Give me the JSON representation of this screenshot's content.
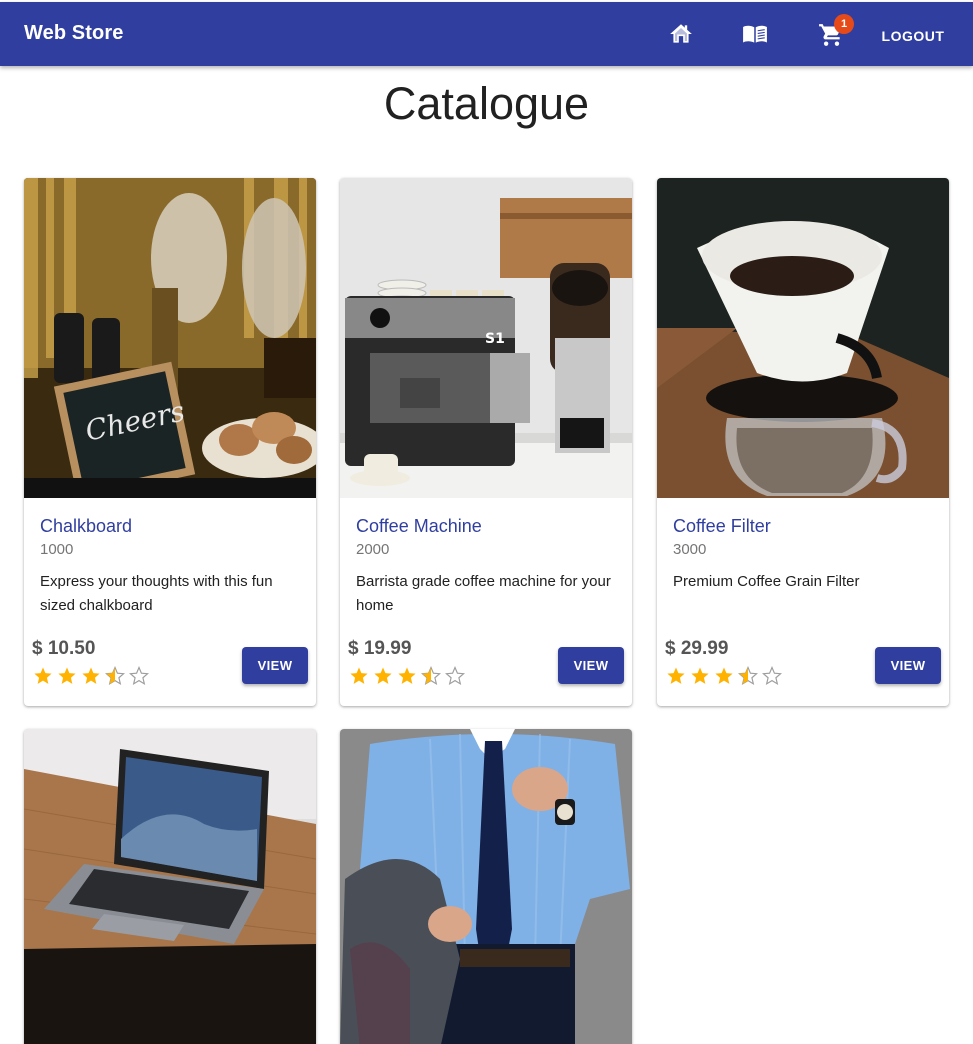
{
  "app": {
    "brand": "Web Store"
  },
  "nav": {
    "home_icon": "home-icon",
    "catalog_icon": "book-open-icon",
    "cart_icon": "cart-icon",
    "cart_count": "1",
    "logout_label": "LOGOUT"
  },
  "page": {
    "title": "Catalogue"
  },
  "colors": {
    "primary": "#303f9f",
    "badge": "#e64a19",
    "star": "#ffb300"
  },
  "products": [
    {
      "title": "Chalkboard",
      "code": "1000",
      "description": "Express your thoughts with this fun sized chalkboard",
      "price": "$ 10.50",
      "rating": 3.5,
      "view_label": "VIEW",
      "image": "chalkboard-photo"
    },
    {
      "title": "Coffee Machine",
      "code": "2000",
      "description": "Barrista grade coffee machine for your home",
      "price": "$ 19.99",
      "rating": 3.5,
      "view_label": "VIEW",
      "image": "coffee-machine-photo"
    },
    {
      "title": "Coffee Filter",
      "code": "3000",
      "description": "Premium Coffee Grain Filter",
      "price": "$ 29.99",
      "rating": 3.5,
      "view_label": "VIEW",
      "image": "coffee-filter-photo"
    },
    {
      "image": "laptop-photo"
    },
    {
      "image": "shirt-tie-photo"
    }
  ]
}
